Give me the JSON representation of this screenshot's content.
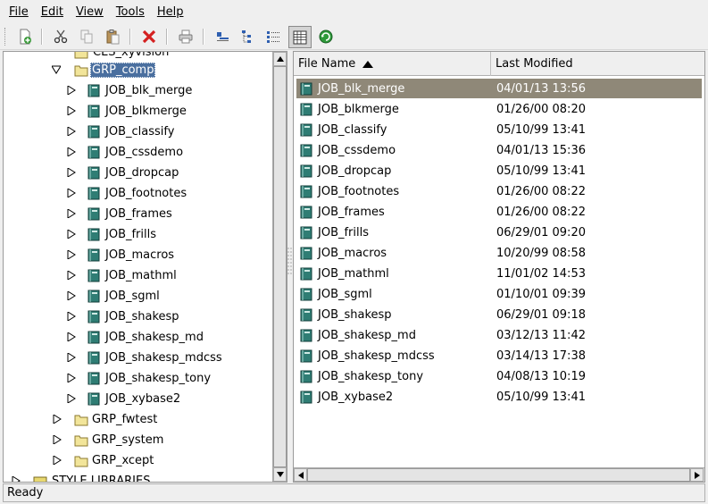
{
  "menu": [
    "File",
    "Edit",
    "View",
    "Tools",
    "Help"
  ],
  "tree": {
    "partial_top": "CES_xyvision",
    "group_selected": "GRP_comp",
    "jobs": [
      "JOB_blk_merge",
      "JOB_blkmerge",
      "JOB_classify",
      "JOB_cssdemo",
      "JOB_dropcap",
      "JOB_footnotes",
      "JOB_frames",
      "JOB_frills",
      "JOB_macros",
      "JOB_mathml",
      "JOB_sgml",
      "JOB_shakesp",
      "JOB_shakesp_md",
      "JOB_shakesp_mdcss",
      "JOB_shakesp_tony",
      "JOB_xybase2"
    ],
    "groups": [
      "GRP_fwtest",
      "GRP_system",
      "GRP_xcept"
    ],
    "partial_bottom": "STYLE LIBRARIES"
  },
  "list": {
    "col_name": "File Name",
    "col_date": "Last Modified",
    "rows": [
      {
        "name": "JOB_blk_merge",
        "date": "04/01/13 13:56"
      },
      {
        "name": "JOB_blkmerge",
        "date": "01/26/00 08:20"
      },
      {
        "name": "JOB_classify",
        "date": "05/10/99 13:41"
      },
      {
        "name": "JOB_cssdemo",
        "date": "04/01/13 15:36"
      },
      {
        "name": "JOB_dropcap",
        "date": "05/10/99 13:41"
      },
      {
        "name": "JOB_footnotes",
        "date": "01/26/00 08:22"
      },
      {
        "name": "JOB_frames",
        "date": "01/26/00 08:22"
      },
      {
        "name": "JOB_frills",
        "date": "06/29/01 09:20"
      },
      {
        "name": "JOB_macros",
        "date": "10/20/99 08:58"
      },
      {
        "name": "JOB_mathml",
        "date": "11/01/02 14:53"
      },
      {
        "name": "JOB_sgml",
        "date": "01/10/01 09:39"
      },
      {
        "name": "JOB_shakesp",
        "date": "06/29/01 09:18"
      },
      {
        "name": "JOB_shakesp_md",
        "date": "03/12/13 11:42"
      },
      {
        "name": "JOB_shakesp_mdcss",
        "date": "03/14/13 17:38"
      },
      {
        "name": "JOB_shakesp_tony",
        "date": "04/08/13 10:19"
      },
      {
        "name": "JOB_xybase2",
        "date": "05/10/99 13:41"
      }
    ]
  },
  "status": "Ready",
  "colors": {
    "selection_tree": "#4a6f9f",
    "selection_list": "#8f8878",
    "folder": "#f2e59a",
    "doc": "#2f7d74"
  }
}
